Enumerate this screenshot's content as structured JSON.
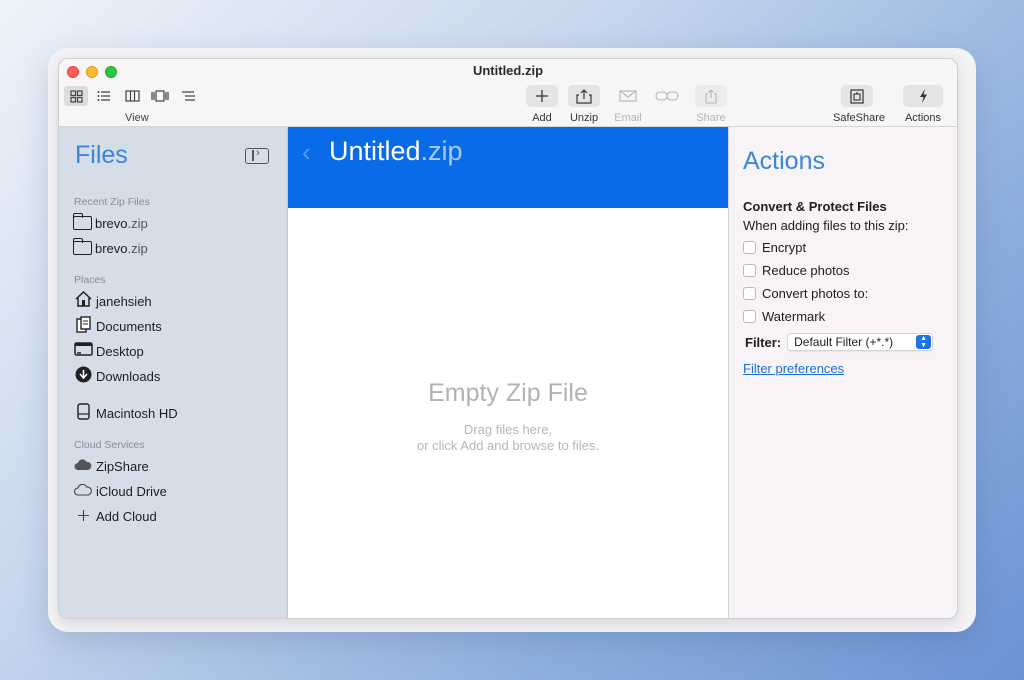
{
  "window": {
    "title": "Untitled.zip"
  },
  "toolbar": {
    "view_label": "View",
    "view_icons": [
      "grid-view-icon",
      "list-view-icon",
      "column-view-icon",
      "gallery-view-icon",
      "outline-view-icon"
    ],
    "add_label": "Add",
    "unzip_label": "Unzip",
    "email_label": "Email",
    "share_label": "Share",
    "safeshare_label": "SafeShare",
    "actions_label": "Actions"
  },
  "sidebar": {
    "title": "Files",
    "recent_label": "Recent Zip Files",
    "recent": [
      {
        "name": "brevo",
        "ext": ".zip"
      },
      {
        "name": "brevo",
        "ext": ".zip"
      }
    ],
    "places_label": "Places",
    "places": [
      {
        "label": "janehsieh",
        "icon": "home-icon"
      },
      {
        "label": "Documents",
        "icon": "documents-icon"
      },
      {
        "label": "Desktop",
        "icon": "desktop-icon"
      },
      {
        "label": "Downloads",
        "icon": "downloads-icon"
      },
      {
        "label": "Macintosh HD",
        "icon": "hard-drive-icon"
      }
    ],
    "cloud_label": "Cloud Services",
    "cloud": [
      {
        "label": "ZipShare",
        "icon": "cloud-filled-icon"
      },
      {
        "label": "iCloud Drive",
        "icon": "cloud-outline-icon"
      },
      {
        "label": "Add Cloud",
        "icon": "plus-icon"
      }
    ]
  },
  "main": {
    "zip_name": "Untitled",
    "zip_ext": ".zip",
    "empty_title": "Empty Zip File",
    "empty_line1": "Drag files here,",
    "empty_line2": "or click Add and browse to files."
  },
  "actions": {
    "title": "Actions",
    "heading": "Convert & Protect Files",
    "subheading": "When adding files to this zip:",
    "options": [
      "Encrypt",
      "Reduce photos",
      "Convert photos to:",
      "Watermark"
    ],
    "filter_label": "Filter:",
    "filter_value": "Default Filter (+*.*)",
    "filter_link": "Filter preferences"
  },
  "colors": {
    "accent": "#0a6be8",
    "title_blue": "#3a86d8",
    "sidebar_bg": "#d5dde9",
    "actions_bg": "#f8f3f7"
  }
}
